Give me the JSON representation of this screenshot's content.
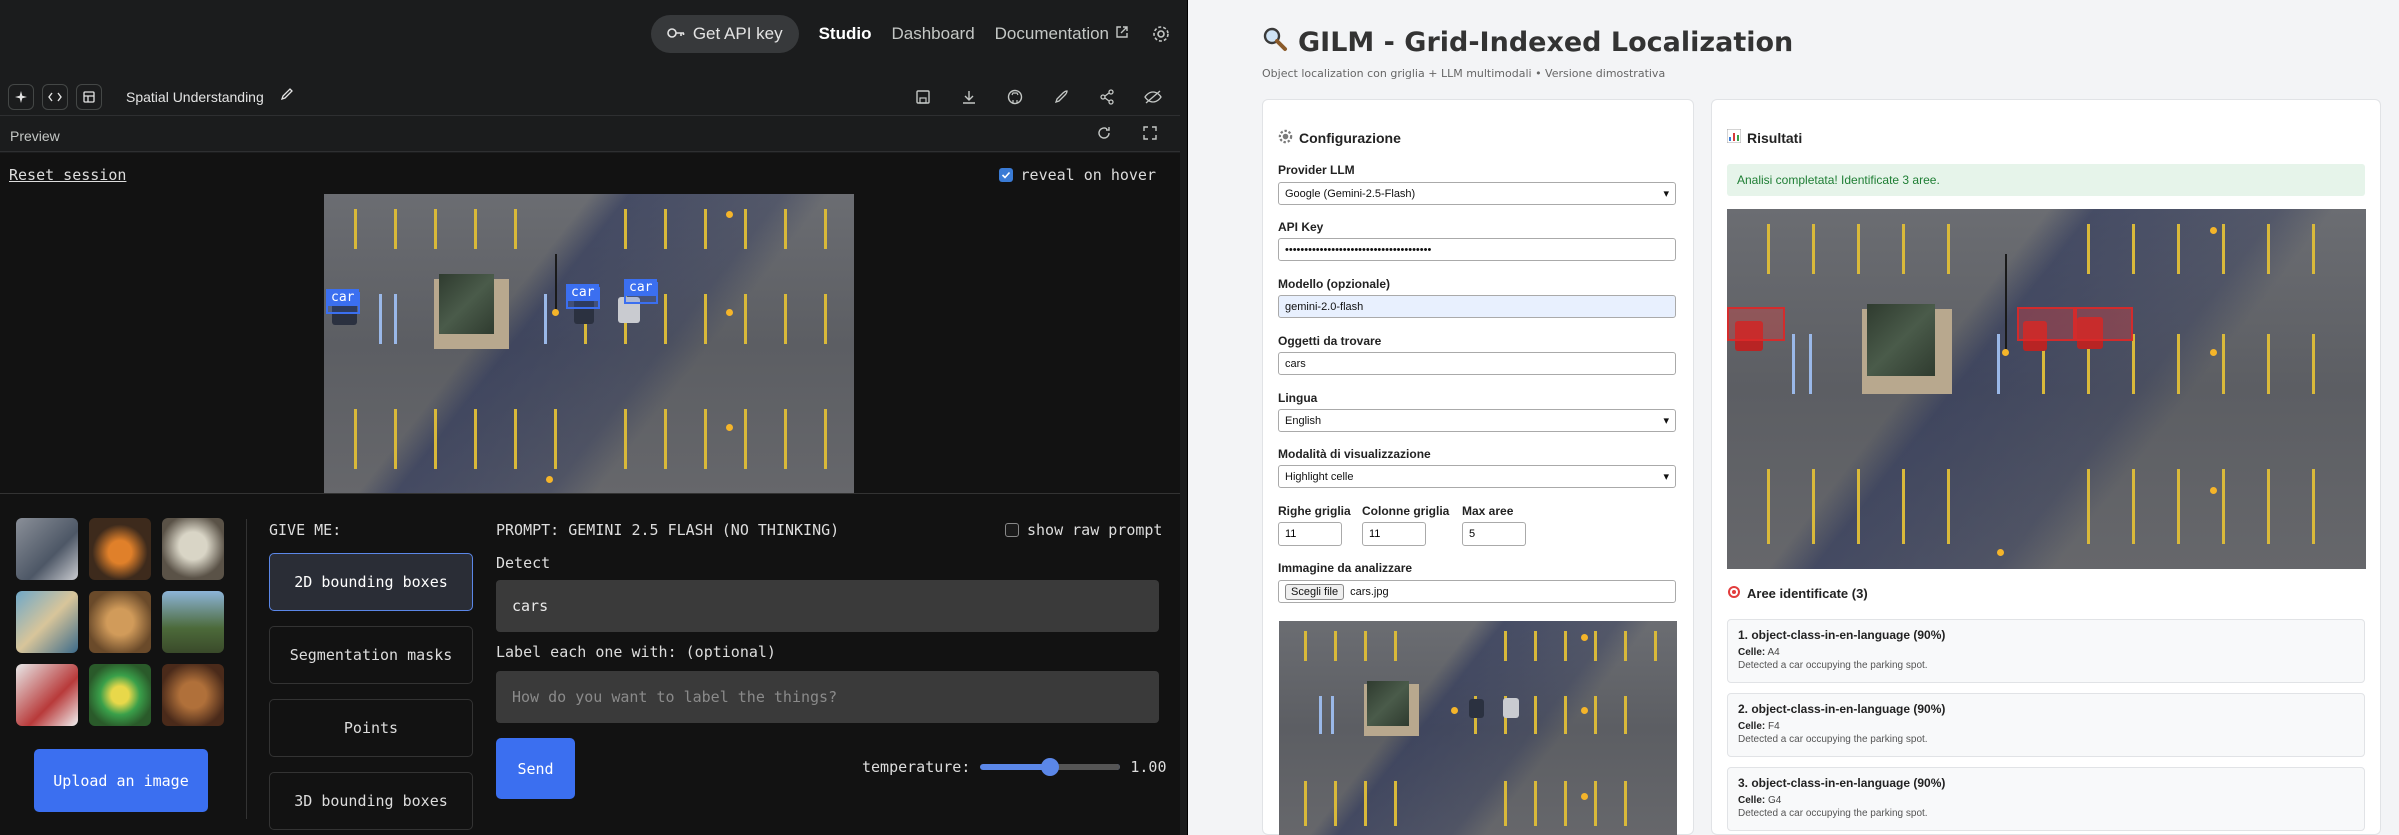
{
  "studio": {
    "topbar": {
      "api_key": "Get API key",
      "links": [
        "Studio",
        "Dashboard",
        "Documentation"
      ]
    },
    "toolbar": {
      "title": "Spatial Understanding"
    },
    "preview": {
      "label": "Preview"
    },
    "app": {
      "reset": "Reset session",
      "reveal": "reveal on hover",
      "detections": [
        {
          "label": "car"
        },
        {
          "label": "car"
        },
        {
          "label": "car"
        }
      ],
      "give_me": "GIVE ME:",
      "modes": [
        "2D bounding boxes",
        "Segmentation masks",
        "Points",
        "3D bounding boxes"
      ],
      "selected_mode": "2D bounding boxes",
      "prompt_header": "PROMPT: GEMINI 2.5 FLASH (NO THINKING)",
      "show_raw_prompt": "show raw prompt",
      "detect_label": "Detect",
      "detect_value": "cars",
      "label_field_label": "Label each one with: (optional)",
      "label_placeholder": "How do you want to label the things?",
      "send": "Send",
      "temperature_label": "temperature:",
      "temperature_value": "1.00",
      "temperature_fraction": 0.5,
      "upload": "Upload an image"
    }
  },
  "gilm": {
    "title": "GILM - Grid-Indexed Localization",
    "subtitle": "Object localization con griglia + LLM multimodali • Versione dimostrativa",
    "config": {
      "title": "Configurazione",
      "provider_label": "Provider LLM",
      "provider_value": "Google (Gemini-2.5-Flash)",
      "api_key_label": "API Key",
      "api_key_value": "••••••••••••••••••••••••••••••••••••••",
      "model_label": "Modello (opzionale)",
      "model_value": "gemini-2.0-flash",
      "objects_label": "Oggetti da trovare",
      "objects_value": "cars",
      "language_label": "Lingua",
      "language_value": "English",
      "mode_label": "Modalità di visualizzazione",
      "mode_value": "Highlight celle",
      "rows_label": "Righe griglia",
      "rows_value": "11",
      "cols_label": "Colonne griglia",
      "cols_value": "11",
      "max_label": "Max aree",
      "max_value": "5",
      "image_label": "Immagine da analizzare",
      "file_button": "Scegli file",
      "file_name": "cars.jpg"
    },
    "results": {
      "title": "Risultati",
      "success": "Analisi completata! Identificate 3 aree.",
      "areas_title": "Aree identificate (3)",
      "cells_label": "Celle:",
      "areas": [
        {
          "title": "1. object-class-in-en-language (90%)",
          "cells": "A4",
          "desc": "Detected a car occupying the parking spot."
        },
        {
          "title": "2. object-class-in-en-language (90%)",
          "cells": "F4",
          "desc": "Detected a car occupying the parking spot."
        },
        {
          "title": "3. object-class-in-en-language (90%)",
          "cells": "G4",
          "desc": "Detected a car occupying the parking spot."
        }
      ]
    }
  },
  "colors": {
    "accent_blue": "#3b6ff0",
    "studio_bg": "#1b1c1d",
    "gilm_bg": "#f3f4f6",
    "success_green": "#1e7e34",
    "highlight_red": "#dc2828"
  },
  "icons": [
    "key-icon",
    "external-link-icon",
    "gear-icon",
    "sparkle-icon",
    "code-icon",
    "layout-icon",
    "pencil-icon",
    "save-icon",
    "download-icon",
    "github-icon",
    "rocket-icon",
    "share-icon",
    "hide-icon",
    "refresh-icon",
    "fullscreen-icon",
    "magnifier-icon",
    "chart-icon",
    "target-icon"
  ]
}
